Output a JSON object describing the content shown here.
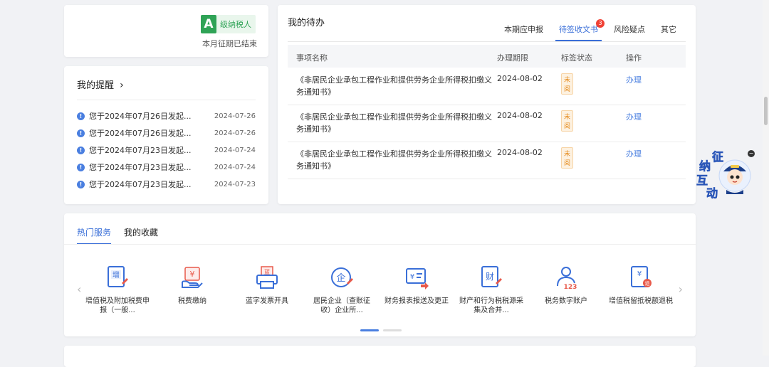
{
  "taxpayer": {
    "level_letter": "A",
    "level_text": "级纳税人",
    "period_status": "本月征期已结束"
  },
  "reminders": {
    "title": "我的提醒",
    "items": [
      {
        "text": "您于2024年07月26日发起...",
        "date": "2024-07-26"
      },
      {
        "text": "您于2024年07月26日发起...",
        "date": "2024-07-26"
      },
      {
        "text": "您于2024年07月23日发起...",
        "date": "2024-07-24"
      },
      {
        "text": "您于2024年07月23日发起...",
        "date": "2024-07-24"
      },
      {
        "text": "您于2024年07月23日发起...",
        "date": "2024-07-23"
      }
    ]
  },
  "todo": {
    "title": "我的待办",
    "tabs": [
      {
        "label": "本期应申报"
      },
      {
        "label": "待签收文书",
        "badge": "3"
      },
      {
        "label": "风险疑点"
      },
      {
        "label": "其它"
      }
    ],
    "columns": [
      "事项名称",
      "办理期限",
      "标签状态",
      "操作"
    ],
    "rows": [
      {
        "name": "《非居民企业承包工程作业和提供劳务企业所得税扣缴义务通知书》",
        "deadline": "2024-08-02",
        "status": "未阅",
        "action": "办理"
      },
      {
        "name": "《非居民企业承包工程作业和提供劳务企业所得税扣缴义务通知书》",
        "deadline": "2024-08-02",
        "status": "未阅",
        "action": "办理"
      },
      {
        "name": "《非居民企业承包工程作业和提供劳务企业所得税扣缴义务通知书》",
        "deadline": "2024-08-02",
        "status": "未阅",
        "action": "办理"
      }
    ]
  },
  "services": {
    "tabs": [
      "热门服务",
      "我的收藏"
    ],
    "items": [
      {
        "label": "增值税及附加税费申报（一般...",
        "icon": "vat-declare-icon"
      },
      {
        "label": "税费缴纳",
        "icon": "tax-payment-icon"
      },
      {
        "label": "蓝字发票开具",
        "icon": "invoice-print-icon"
      },
      {
        "label": "居民企业（查账征收）企业所...",
        "icon": "enterprise-tax-icon"
      },
      {
        "label": "财务报表报送及更正",
        "icon": "financial-report-icon"
      },
      {
        "label": "财产和行为税税源采集及合并...",
        "icon": "property-tax-icon"
      },
      {
        "label": "税务数字账户",
        "icon": "digital-account-icon"
      },
      {
        "label": "增值税留抵税额退税",
        "icon": "vat-refund-icon"
      }
    ]
  },
  "widget": {
    "chars": [
      "征",
      "纳",
      "互",
      "动"
    ]
  },
  "colors": {
    "accent": "#3a6fd8",
    "brand_green": "#2fa356",
    "badge_red": "#f04134",
    "tag_orange": "#e58c1f"
  }
}
